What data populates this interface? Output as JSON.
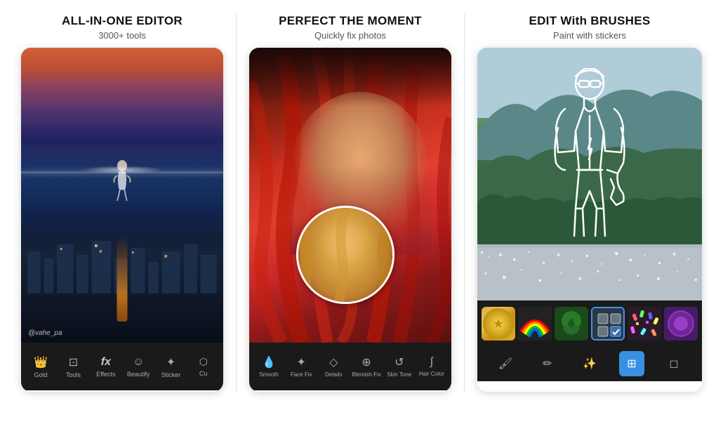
{
  "panels": [
    {
      "id": "panel-1",
      "title": "ALL-IN-ONE EDITOR",
      "subtitle": "3000+ tools",
      "watermark": "@vahe_pa",
      "toolbar_items": [
        {
          "icon": "👑",
          "label": "Gold",
          "active": false
        },
        {
          "icon": "⊡",
          "label": "Tools",
          "active": false
        },
        {
          "icon": "fx",
          "label": "Effects",
          "active": false
        },
        {
          "icon": "☺",
          "label": "Beautify",
          "active": false
        },
        {
          "icon": "✦",
          "label": "Sticker",
          "active": false
        },
        {
          "icon": "⬡",
          "label": "Cu",
          "active": false
        }
      ]
    },
    {
      "id": "panel-2",
      "title": "PERFECT THE MOMENT",
      "subtitle": "Quickly fix photos",
      "toolbar_items": [
        {
          "icon": "💧",
          "label": "Smooth",
          "active": false
        },
        {
          "icon": "✦",
          "label": "Face Fix",
          "active": false
        },
        {
          "icon": "◇",
          "label": "Details",
          "active": false
        },
        {
          "icon": "⊕",
          "label": "Blemish Fix",
          "active": false
        },
        {
          "icon": "⟳",
          "label": "Skin Tone",
          "active": false
        },
        {
          "icon": "∫",
          "label": "Hair Color",
          "active": false
        }
      ]
    },
    {
      "id": "panel-3",
      "title": "EDIT With BRUSHES",
      "subtitle": "Paint with stickers",
      "sticker_items": [
        {
          "type": "gold",
          "label": "Gold sticker"
        },
        {
          "type": "rainbow",
          "label": "Rainbow sticker"
        },
        {
          "type": "green",
          "label": "Green sticker"
        },
        {
          "type": "selected",
          "label": "Selected sticker"
        },
        {
          "type": "confetti",
          "label": "Confetti sticker"
        },
        {
          "type": "purple",
          "label": "Purple sticker"
        }
      ],
      "brush_tools": [
        {
          "icon": "🖌",
          "label": "brush",
          "active": false
        },
        {
          "icon": "✏",
          "label": "pen",
          "active": false
        },
        {
          "icon": "✨",
          "label": "sparkle",
          "active": false
        },
        {
          "icon": "⊞",
          "label": "grid-brush",
          "active": true
        },
        {
          "icon": "◻",
          "label": "eraser",
          "active": false
        }
      ]
    }
  ]
}
